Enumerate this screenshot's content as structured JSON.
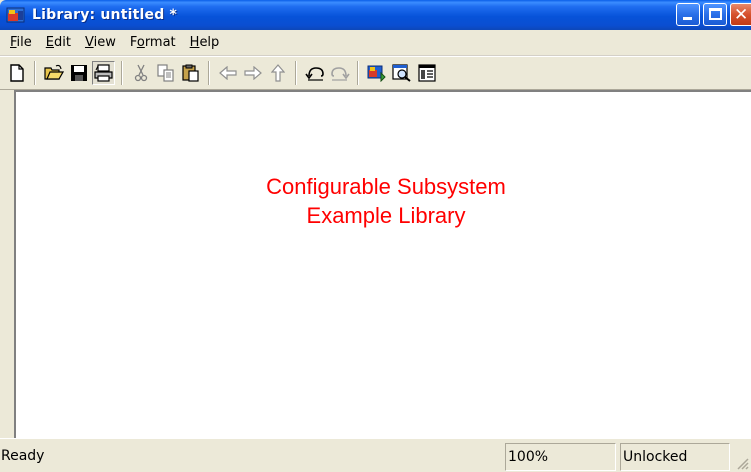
{
  "window": {
    "title": "Library: untitled *",
    "titlebar_color": "#0a4ed1",
    "caption_buttons": [
      "minimize-icon",
      "maximize-icon",
      "close-icon"
    ]
  },
  "menubar": {
    "items": [
      {
        "label_acc": "F",
        "label_rest": "ile"
      },
      {
        "label_acc": "E",
        "label_rest": "dit"
      },
      {
        "label_acc": "V",
        "label_rest": "iew"
      },
      {
        "label_pre": "F",
        "label_acc": "o",
        "label_rest": "rmat"
      },
      {
        "label_acc": "H",
        "label_rest": "elp"
      }
    ]
  },
  "toolbar": {
    "icons": [
      "new-file-icon",
      "open-folder-icon",
      "save-icon",
      "print-icon",
      "cut-icon",
      "copy-icon",
      "paste-icon",
      "back-icon",
      "forward-icon",
      "up-icon",
      "undo-icon",
      "redo-icon",
      "library-browser-icon",
      "model-explorer-icon",
      "model-properties-icon"
    ]
  },
  "canvas": {
    "annotation_line1": "Configurable Subsystem",
    "annotation_line2": "Example Library",
    "annotation_color": "#ff0000"
  },
  "statusbar": {
    "status": "Ready",
    "zoom": "100%",
    "lock_state": "Unlocked"
  }
}
